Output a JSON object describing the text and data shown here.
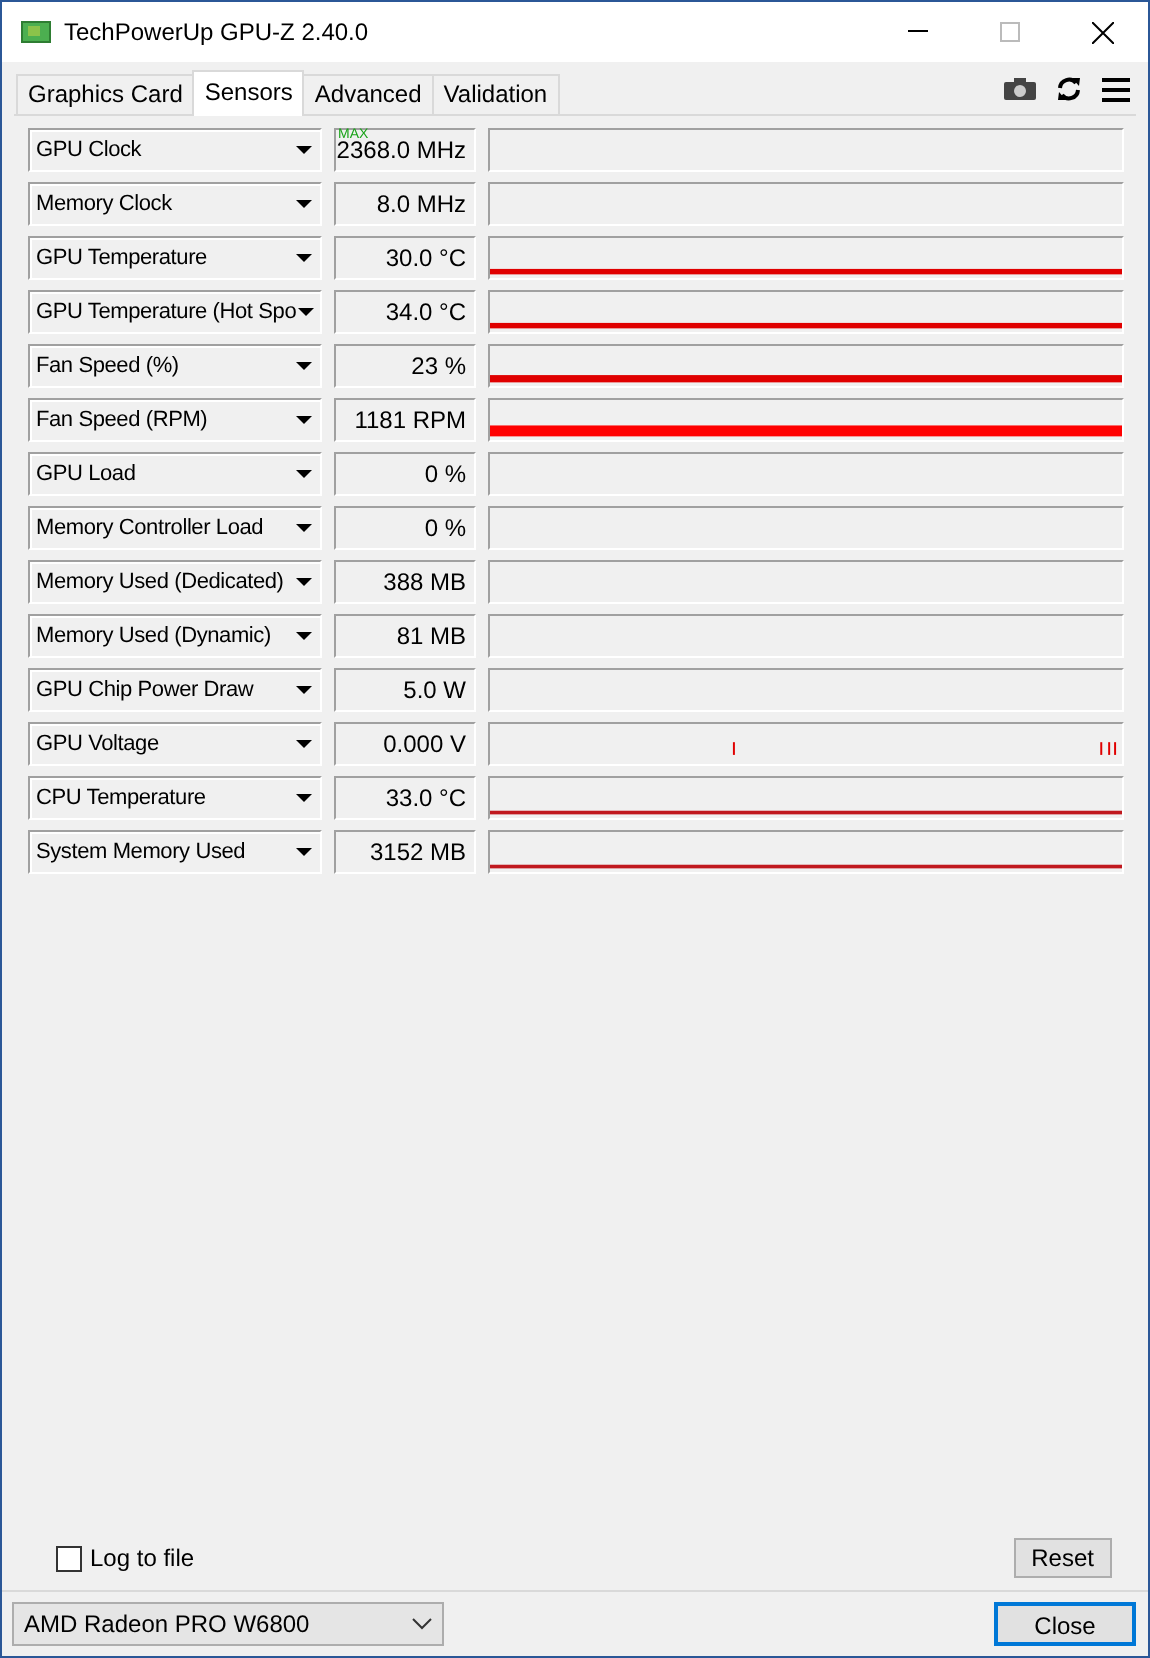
{
  "window": {
    "title": "TechPowerUp GPU-Z 2.40.0"
  },
  "tabs": [
    {
      "label": "Graphics Card",
      "selected": false
    },
    {
      "label": "Sensors",
      "selected": true
    },
    {
      "label": "Advanced",
      "selected": false
    },
    {
      "label": "Validation",
      "selected": false
    }
  ],
  "sensors": [
    {
      "name": "GPU Clock",
      "value": "2368.0 MHz",
      "badge": "MAX",
      "kind": "empty"
    },
    {
      "name": "Memory Clock",
      "value": "8.0 MHz",
      "kind": "empty"
    },
    {
      "name": "GPU Temperature",
      "value": "30.0 °C",
      "kind": "thin"
    },
    {
      "name": "GPU Temperature (Hot Spo",
      "value": "34.0 °C",
      "kind": "thin"
    },
    {
      "name": "Fan Speed (%)",
      "value": "23 %",
      "kind": "medium"
    },
    {
      "name": "Fan Speed (RPM)",
      "value": "1181 RPM",
      "kind": "thick"
    },
    {
      "name": "GPU Load",
      "value": "0 %",
      "kind": "empty"
    },
    {
      "name": "Memory Controller Load",
      "value": "0 %",
      "kind": "empty"
    },
    {
      "name": "Memory Used (Dedicated)",
      "value": "388 MB",
      "kind": "empty"
    },
    {
      "name": "Memory Used (Dynamic)",
      "value": "81 MB",
      "kind": "empty"
    },
    {
      "name": "GPU Chip Power Draw",
      "value": "5.0 W",
      "kind": "empty"
    },
    {
      "name": "GPU Voltage",
      "value": "0.000 V",
      "kind": "spikes"
    },
    {
      "name": "CPU Temperature",
      "value": "33.0 °C",
      "kind": "hairline"
    },
    {
      "name": "System Memory Used",
      "value": "3152 MB",
      "kind": "hairline"
    }
  ],
  "log_to_file": {
    "label": "Log to file",
    "checked": false
  },
  "reset_button": "Reset",
  "device_select": {
    "value": "AMD Radeon PRO W6800"
  },
  "close_button": "Close"
}
